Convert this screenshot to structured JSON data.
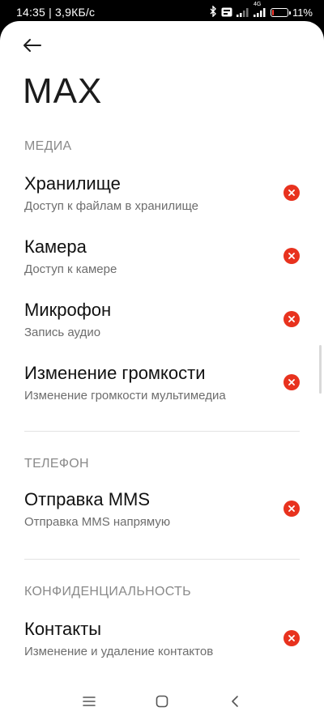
{
  "status_bar": {
    "time_speed": "14:35 | 3,9КБ/с",
    "network_type": "4G",
    "battery_percent": "11%",
    "battery_level": 0.11,
    "icons": [
      "bluetooth-icon",
      "vpn-icon",
      "signal-icon",
      "wifi-signal-icon",
      "battery-icon"
    ]
  },
  "header": {
    "back_icon": "arrow-left-icon",
    "title": "MAX"
  },
  "sections": [
    {
      "label": "МЕДИА",
      "items": [
        {
          "title": "Хранилище",
          "subtitle": "Доступ к файлам в хранилище",
          "status": "denied"
        },
        {
          "title": "Камера",
          "subtitle": "Доступ к камере",
          "status": "denied"
        },
        {
          "title": "Микрофон",
          "subtitle": "Запись аудио",
          "status": "denied"
        },
        {
          "title": "Изменение громкости",
          "subtitle": "Изменение громкости мультимедиа",
          "status": "denied"
        }
      ]
    },
    {
      "label": "ТЕЛЕФОН",
      "items": [
        {
          "title": "Отправка MMS",
          "subtitle": "Отправка MMS напрямую",
          "status": "denied"
        }
      ]
    },
    {
      "label": "КОНФИДЕНЦИАЛЬНОСТЬ",
      "items": [
        {
          "title": "Контакты",
          "subtitle": "Изменение и удаление контактов",
          "status": "denied"
        }
      ]
    }
  ],
  "colors": {
    "denied": "#e8321e",
    "section_label": "#8a8a8a",
    "title": "#111111",
    "subtitle": "#6d6d6d"
  },
  "nav_bar": {
    "icons": [
      "menu-icon",
      "home-icon",
      "back-icon"
    ]
  }
}
